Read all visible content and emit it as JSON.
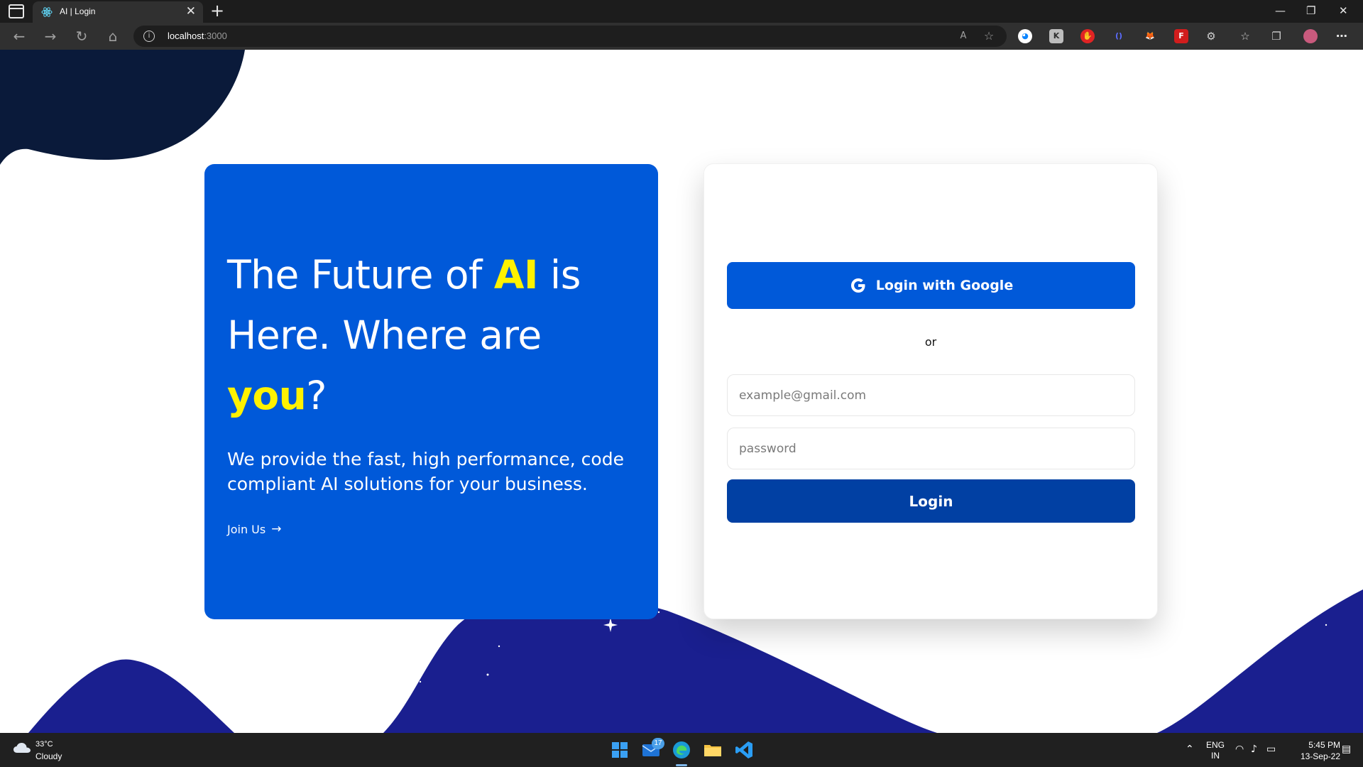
{
  "browser": {
    "tab_title": "AI | Login",
    "tab_close": "✕",
    "new_tab": "+",
    "url_host": "localhost",
    "url_port": ":3000",
    "window_controls": {
      "minimize": "—",
      "restore": "❐",
      "close": "✕"
    }
  },
  "hero": {
    "title_part1": "The Future of ",
    "title_highlight1": "AI",
    "title_part2": " is Here. Where are ",
    "title_highlight2": "you",
    "title_part3": "?",
    "subtitle": "We provide the fast, high performance, code compliant AI solutions for your business.",
    "cta_label": "Join Us",
    "cta_arrow": "→"
  },
  "login_card": {
    "google_button_label": "Login with Google",
    "divider_text": "or",
    "email_placeholder": "example@gmail.com",
    "password_placeholder": "password",
    "login_button_label": "Login"
  },
  "colors": {
    "primary_blue": "#0059d9",
    "login_button_blue": "#0140a3",
    "highlight_yellow": "#fff200",
    "wave_navy": "#1a1f8f",
    "blob_navy": "#0a1a3a"
  },
  "taskbar": {
    "weather_temp": "33°C",
    "weather_desc": "Cloudy",
    "mail_badge": "17",
    "lang_line1": "ENG",
    "lang_line2": "IN",
    "time": "5:45 PM",
    "date": "13-Sep-22"
  }
}
